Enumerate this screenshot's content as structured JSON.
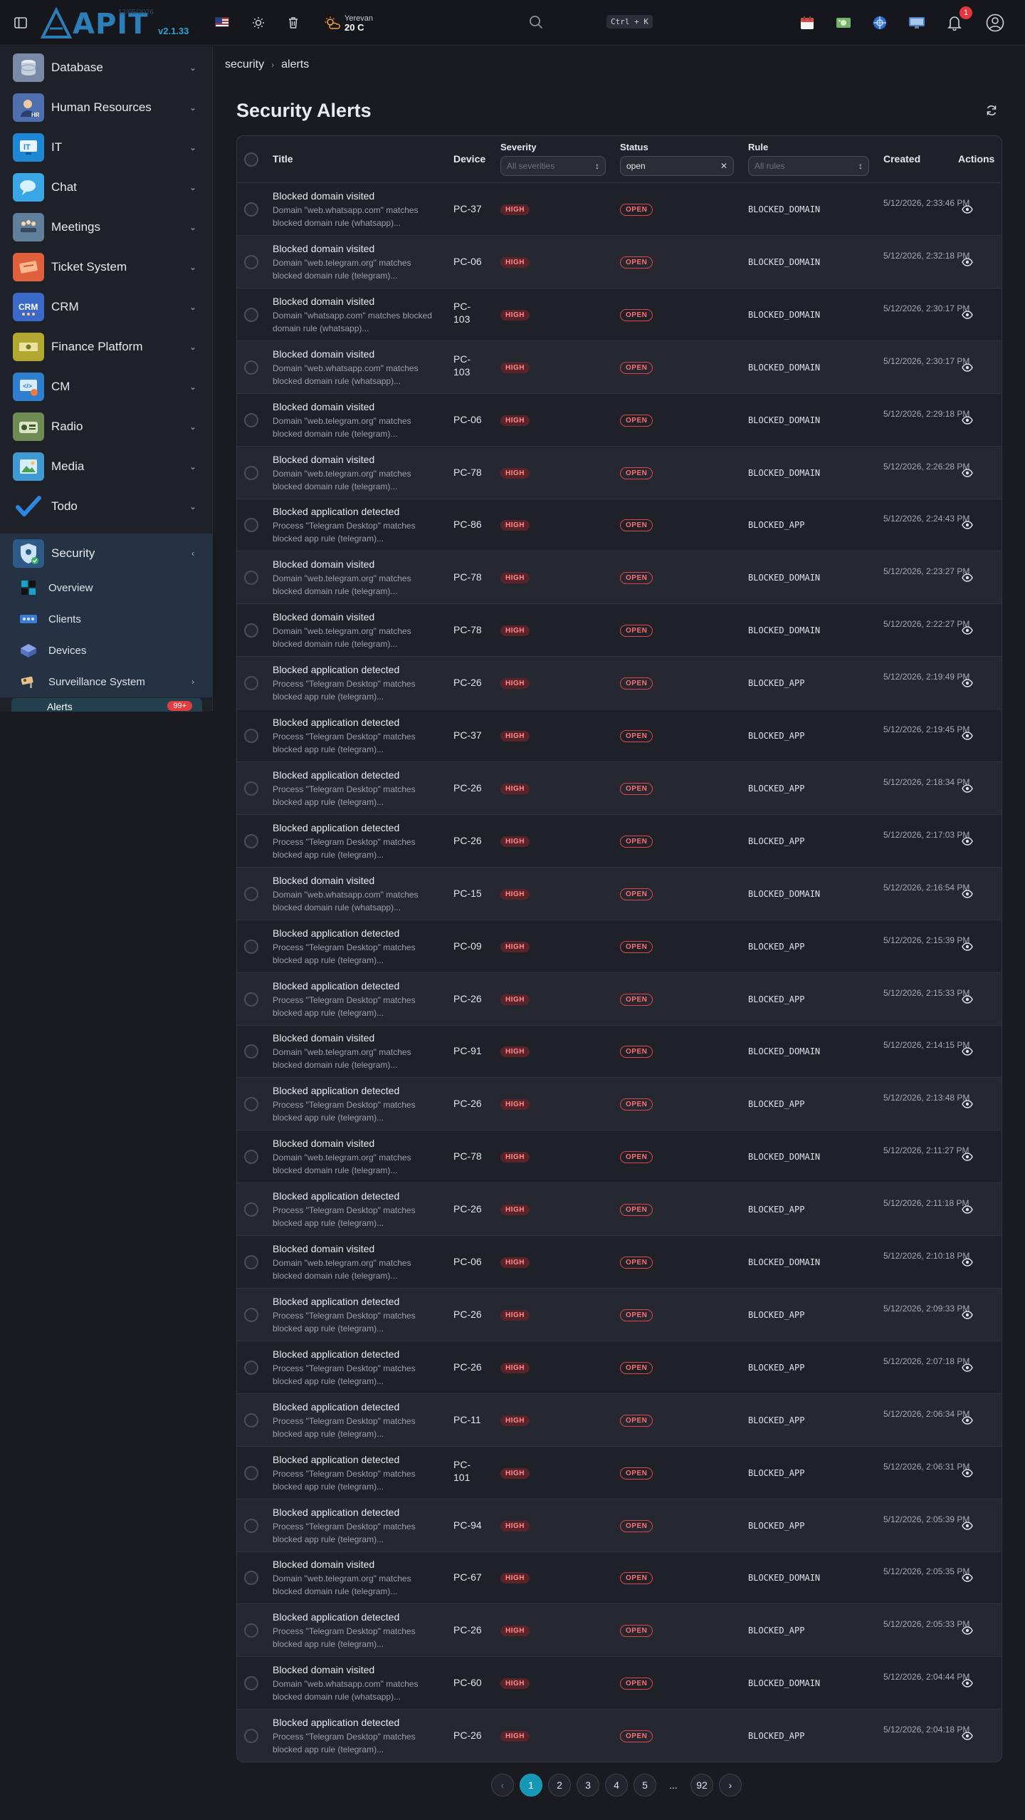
{
  "header": {
    "logo_text": "APIT",
    "logo_date": "12/05/2026",
    "version": "v2.1.33",
    "weather_city": "Yerevan",
    "weather_temp": "20 C",
    "shortcut": "Ctrl + K",
    "notifications_count": "1"
  },
  "sidebar": {
    "items": [
      {
        "label": "Database",
        "icon": "database-icon",
        "color": "#7a8aa6"
      },
      {
        "label": "Human Resources",
        "icon": "hr-icon",
        "color": "#4f6fae"
      },
      {
        "label": "IT",
        "icon": "it-icon",
        "color": "#1e88d6"
      },
      {
        "label": "Chat",
        "icon": "chat-icon",
        "color": "#39a6e6"
      },
      {
        "label": "Meetings",
        "icon": "meetings-icon",
        "color": "#5f7f9a"
      },
      {
        "label": "Ticket System",
        "icon": "ticket-icon",
        "color": "#e0603c"
      },
      {
        "label": "CRM",
        "icon": "crm-icon",
        "color": "#3a69c9"
      },
      {
        "label": "Finance Platform",
        "icon": "finance-icon",
        "color": "#b2a82f"
      },
      {
        "label": "CM",
        "icon": "cm-icon",
        "color": "#2f7fd1"
      },
      {
        "label": "Radio",
        "icon": "radio-icon",
        "color": "#6f8a52"
      },
      {
        "label": "Media",
        "icon": "media-icon",
        "color": "#3f9ad4"
      },
      {
        "label": "Todo",
        "icon": "todo-icon",
        "color": "#2a86e0"
      },
      {
        "label": "Security",
        "icon": "security-icon",
        "color": "#2d5a87"
      }
    ],
    "security_sub": [
      {
        "label": "Overview",
        "icon": "overview-icon"
      },
      {
        "label": "Clients",
        "icon": "clients-icon"
      },
      {
        "label": "Devices",
        "icon": "devices-icon"
      },
      {
        "label": "Surveillance System",
        "icon": "surveillance-icon"
      }
    ],
    "alerts_label": "Alerts",
    "alerts_badge": "99+"
  },
  "breadcrumb": [
    "security",
    "alerts"
  ],
  "page_title": "Security Alerts",
  "table": {
    "columns": {
      "title": "Title",
      "device": "Device",
      "severity": "Severity",
      "status": "Status",
      "rule": "Rule",
      "created": "Created",
      "actions": "Actions"
    },
    "filters": {
      "severity_placeholder": "All severities",
      "status_value": "open",
      "rule_placeholder": "All rules"
    },
    "rows": [
      {
        "title": "Blocked domain visited",
        "desc": "Domain \"web.whatsapp.com\" matches blocked domain rule (whatsapp)...",
        "device": "PC-37",
        "severity": "HIGH",
        "status": "OPEN",
        "rule": "BLOCKED_DOMAIN",
        "created": "5/12/2026, 2:33:46 PM"
      },
      {
        "title": "Blocked domain visited",
        "desc": "Domain \"web.telegram.org\" matches blocked domain rule (telegram)...",
        "device": "PC-06",
        "severity": "HIGH",
        "status": "OPEN",
        "rule": "BLOCKED_DOMAIN",
        "created": "5/12/2026, 2:32:18 PM"
      },
      {
        "title": "Blocked domain visited",
        "desc": "Domain \"whatsapp.com\" matches blocked domain rule (whatsapp)...",
        "device": "PC-103",
        "severity": "HIGH",
        "status": "OPEN",
        "rule": "BLOCKED_DOMAIN",
        "created": "5/12/2026, 2:30:17 PM"
      },
      {
        "title": "Blocked domain visited",
        "desc": "Domain \"web.whatsapp.com\" matches blocked domain rule (whatsapp)...",
        "device": "PC-103",
        "severity": "HIGH",
        "status": "OPEN",
        "rule": "BLOCKED_DOMAIN",
        "created": "5/12/2026, 2:30:17 PM"
      },
      {
        "title": "Blocked domain visited",
        "desc": "Domain \"web.telegram.org\" matches blocked domain rule (telegram)...",
        "device": "PC-06",
        "severity": "HIGH",
        "status": "OPEN",
        "rule": "BLOCKED_DOMAIN",
        "created": "5/12/2026, 2:29:18 PM"
      },
      {
        "title": "Blocked domain visited",
        "desc": "Domain \"web.telegram.org\" matches blocked domain rule (telegram)...",
        "device": "PC-78",
        "severity": "HIGH",
        "status": "OPEN",
        "rule": "BLOCKED_DOMAIN",
        "created": "5/12/2026, 2:26:28 PM"
      },
      {
        "title": "Blocked application detected",
        "desc": "Process \"Telegram Desktop\" matches blocked app rule (telegram)...",
        "device": "PC-86",
        "severity": "HIGH",
        "status": "OPEN",
        "rule": "BLOCKED_APP",
        "created": "5/12/2026, 2:24:43 PM"
      },
      {
        "title": "Blocked domain visited",
        "desc": "Domain \"web.telegram.org\" matches blocked domain rule (telegram)...",
        "device": "PC-78",
        "severity": "HIGH",
        "status": "OPEN",
        "rule": "BLOCKED_DOMAIN",
        "created": "5/12/2026, 2:23:27 PM"
      },
      {
        "title": "Blocked domain visited",
        "desc": "Domain \"web.telegram.org\" matches blocked domain rule (telegram)...",
        "device": "PC-78",
        "severity": "HIGH",
        "status": "OPEN",
        "rule": "BLOCKED_DOMAIN",
        "created": "5/12/2026, 2:22:27 PM"
      },
      {
        "title": "Blocked application detected",
        "desc": "Process \"Telegram Desktop\" matches blocked app rule (telegram)...",
        "device": "PC-26",
        "severity": "HIGH",
        "status": "OPEN",
        "rule": "BLOCKED_APP",
        "created": "5/12/2026, 2:19:49 PM"
      },
      {
        "title": "Blocked application detected",
        "desc": "Process \"Telegram Desktop\" matches blocked app rule (telegram)...",
        "device": "PC-37",
        "severity": "HIGH",
        "status": "OPEN",
        "rule": "BLOCKED_APP",
        "created": "5/12/2026, 2:19:45 PM"
      },
      {
        "title": "Blocked application detected",
        "desc": "Process \"Telegram Desktop\" matches blocked app rule (telegram)...",
        "device": "PC-26",
        "severity": "HIGH",
        "status": "OPEN",
        "rule": "BLOCKED_APP",
        "created": "5/12/2026, 2:18:34 PM"
      },
      {
        "title": "Blocked application detected",
        "desc": "Process \"Telegram Desktop\" matches blocked app rule (telegram)...",
        "device": "PC-26",
        "severity": "HIGH",
        "status": "OPEN",
        "rule": "BLOCKED_APP",
        "created": "5/12/2026, 2:17:03 PM"
      },
      {
        "title": "Blocked domain visited",
        "desc": "Domain \"web.whatsapp.com\" matches blocked domain rule (whatsapp)...",
        "device": "PC-15",
        "severity": "HIGH",
        "status": "OPEN",
        "rule": "BLOCKED_DOMAIN",
        "created": "5/12/2026, 2:16:54 PM"
      },
      {
        "title": "Blocked application detected",
        "desc": "Process \"Telegram Desktop\" matches blocked app rule (telegram)...",
        "device": "PC-09",
        "severity": "HIGH",
        "status": "OPEN",
        "rule": "BLOCKED_APP",
        "created": "5/12/2026, 2:15:39 PM"
      },
      {
        "title": "Blocked application detected",
        "desc": "Process \"Telegram Desktop\" matches blocked app rule (telegram)...",
        "device": "PC-26",
        "severity": "HIGH",
        "status": "OPEN",
        "rule": "BLOCKED_APP",
        "created": "5/12/2026, 2:15:33 PM"
      },
      {
        "title": "Blocked domain visited",
        "desc": "Domain \"web.telegram.org\" matches blocked domain rule (telegram)...",
        "device": "PC-91",
        "severity": "HIGH",
        "status": "OPEN",
        "rule": "BLOCKED_DOMAIN",
        "created": "5/12/2026, 2:14:15 PM"
      },
      {
        "title": "Blocked application detected",
        "desc": "Process \"Telegram Desktop\" matches blocked app rule (telegram)...",
        "device": "PC-26",
        "severity": "HIGH",
        "status": "OPEN",
        "rule": "BLOCKED_APP",
        "created": "5/12/2026, 2:13:48 PM"
      },
      {
        "title": "Blocked domain visited",
        "desc": "Domain \"web.telegram.org\" matches blocked domain rule (telegram)...",
        "device": "PC-78",
        "severity": "HIGH",
        "status": "OPEN",
        "rule": "BLOCKED_DOMAIN",
        "created": "5/12/2026, 2:11:27 PM"
      },
      {
        "title": "Blocked application detected",
        "desc": "Process \"Telegram Desktop\" matches blocked app rule (telegram)...",
        "device": "PC-26",
        "severity": "HIGH",
        "status": "OPEN",
        "rule": "BLOCKED_APP",
        "created": "5/12/2026, 2:11:18 PM"
      },
      {
        "title": "Blocked domain visited",
        "desc": "Domain \"web.telegram.org\" matches blocked domain rule (telegram)...",
        "device": "PC-06",
        "severity": "HIGH",
        "status": "OPEN",
        "rule": "BLOCKED_DOMAIN",
        "created": "5/12/2026, 2:10:18 PM"
      },
      {
        "title": "Blocked application detected",
        "desc": "Process \"Telegram Desktop\" matches blocked app rule (telegram)...",
        "device": "PC-26",
        "severity": "HIGH",
        "status": "OPEN",
        "rule": "BLOCKED_APP",
        "created": "5/12/2026, 2:09:33 PM"
      },
      {
        "title": "Blocked application detected",
        "desc": "Process \"Telegram Desktop\" matches blocked app rule (telegram)...",
        "device": "PC-26",
        "severity": "HIGH",
        "status": "OPEN",
        "rule": "BLOCKED_APP",
        "created": "5/12/2026, 2:07:18 PM"
      },
      {
        "title": "Blocked application detected",
        "desc": "Process \"Telegram Desktop\" matches blocked app rule (telegram)...",
        "device": "PC-11",
        "severity": "HIGH",
        "status": "OPEN",
        "rule": "BLOCKED_APP",
        "created": "5/12/2026, 2:06:34 PM"
      },
      {
        "title": "Blocked application detected",
        "desc": "Process \"Telegram Desktop\" matches blocked app rule (telegram)...",
        "device": "PC-101",
        "severity": "HIGH",
        "status": "OPEN",
        "rule": "BLOCKED_APP",
        "created": "5/12/2026, 2:06:31 PM"
      },
      {
        "title": "Blocked application detected",
        "desc": "Process \"Telegram Desktop\" matches blocked app rule (telegram)...",
        "device": "PC-94",
        "severity": "HIGH",
        "status": "OPEN",
        "rule": "BLOCKED_APP",
        "created": "5/12/2026, 2:05:39 PM"
      },
      {
        "title": "Blocked domain visited",
        "desc": "Domain \"web.telegram.org\" matches blocked domain rule (telegram)...",
        "device": "PC-67",
        "severity": "HIGH",
        "status": "OPEN",
        "rule": "BLOCKED_DOMAIN",
        "created": "5/12/2026, 2:05:35 PM"
      },
      {
        "title": "Blocked application detected",
        "desc": "Process \"Telegram Desktop\" matches blocked app rule (telegram)...",
        "device": "PC-26",
        "severity": "HIGH",
        "status": "OPEN",
        "rule": "BLOCKED_APP",
        "created": "5/12/2026, 2:05:33 PM"
      },
      {
        "title": "Blocked domain visited",
        "desc": "Domain \"web.whatsapp.com\" matches blocked domain rule (whatsapp)...",
        "device": "PC-60",
        "severity": "HIGH",
        "status": "OPEN",
        "rule": "BLOCKED_DOMAIN",
        "created": "5/12/2026, 2:04:44 PM"
      },
      {
        "title": "Blocked application detected",
        "desc": "Process \"Telegram Desktop\" matches blocked app rule (telegram)...",
        "device": "PC-26",
        "severity": "HIGH",
        "status": "OPEN",
        "rule": "BLOCKED_APP",
        "created": "5/12/2026, 2:04:18 PM"
      }
    ]
  },
  "pagination": {
    "prev": "‹",
    "pages": [
      "1",
      "2",
      "3",
      "4",
      "5"
    ],
    "ellipsis": "...",
    "last": "92",
    "next": "›",
    "current": "1"
  },
  "colors": {
    "accent": "#1597b5",
    "danger": "#e5363b",
    "sidebar_active": "#243244"
  }
}
